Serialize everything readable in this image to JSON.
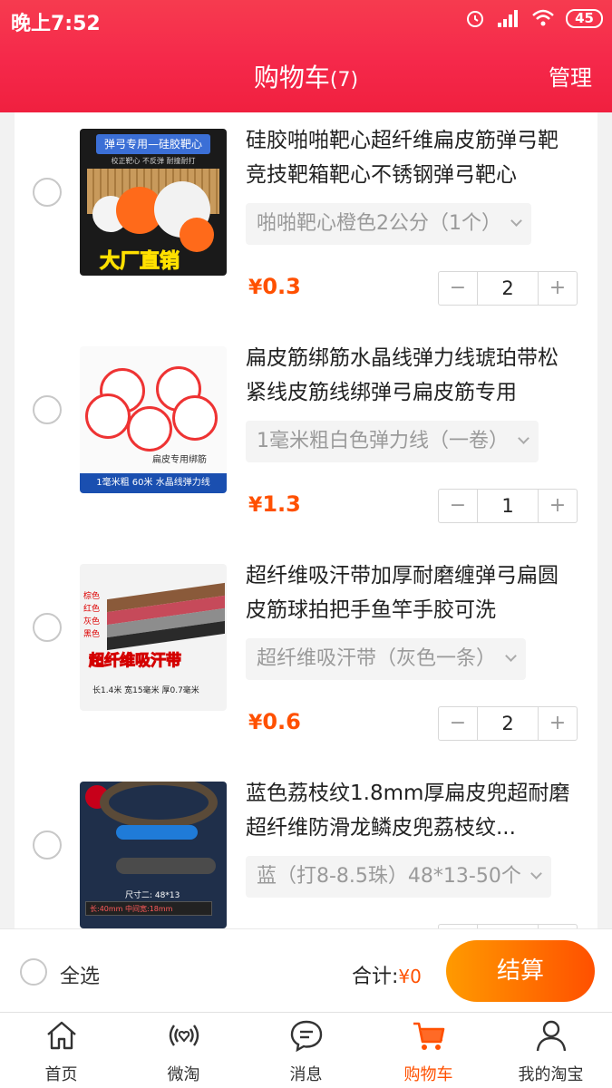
{
  "status": {
    "time": "晚上7:52",
    "battery": "45"
  },
  "header": {
    "title": "购物车",
    "count": "(7)",
    "manage_label": "管理"
  },
  "items": [
    {
      "title": "硅胶啪啪靶心超纤维扁皮筋弹弓靶竞技靶箱靶心不锈钢弹弓靶心",
      "sku": "啪啪靶心橙色2公分（1个）",
      "price": "0.3",
      "qty": "2",
      "thumb_text": {
        "band": "弹弓专用—硅胶靶心",
        "sub": "校正靶心  不反弹  耐撞耐打",
        "banner": "大厂直销"
      }
    },
    {
      "title": "扁皮筋绑筋水晶线弹力线琥珀带松紧线皮筋线绑弹弓扁皮筋专用",
      "sku": "1毫米粗白色弹力线（一卷）",
      "price": "1.3",
      "qty": "1",
      "thumb_text": {
        "caption": "扁皮专用绑筋",
        "band": "1毫米粗 60米 水晶线弹力线"
      }
    },
    {
      "title": "超纤维吸汗带加厚耐磨缠弹弓扁圆皮筋球拍把手鱼竿手胶可洗",
      "sku": "超纤维吸汗带（灰色一条）",
      "price": "0.6",
      "qty": "2",
      "thumb_text": {
        "colors": [
          "棕色",
          "红色",
          "灰色",
          "黑色"
        ],
        "big": "超纤维吸汗带",
        "dims": "长1.4米 宽15毫米 厚0.7毫米"
      }
    },
    {
      "title": "蓝色荔枝纹1.8mm厚扁皮兜超耐磨超纤维防滑龙鳞皮兜荔枝纹...",
      "sku": "蓝（打8-8.5珠）48*13-50个",
      "price": "",
      "qty": "",
      "thumb_text": {
        "size": "尺寸二: 48*13",
        "bar": "长:40mm 中间宽:18mm"
      }
    }
  ],
  "footer": {
    "select_all_label": "全选",
    "total_label": "合计:",
    "total_amount": "¥0",
    "checkout_label": "结算"
  },
  "currency": "¥",
  "tabs": [
    {
      "label": "首页",
      "icon": "home-icon"
    },
    {
      "label": "微淘",
      "icon": "weitao-icon"
    },
    {
      "label": "消息",
      "icon": "message-icon"
    },
    {
      "label": "购物车",
      "icon": "cart-icon",
      "active": true
    },
    {
      "label": "我的淘宝",
      "icon": "profile-icon"
    }
  ],
  "colors": {
    "header_red": "#f5284a",
    "accent_orange": "#ff5000"
  }
}
